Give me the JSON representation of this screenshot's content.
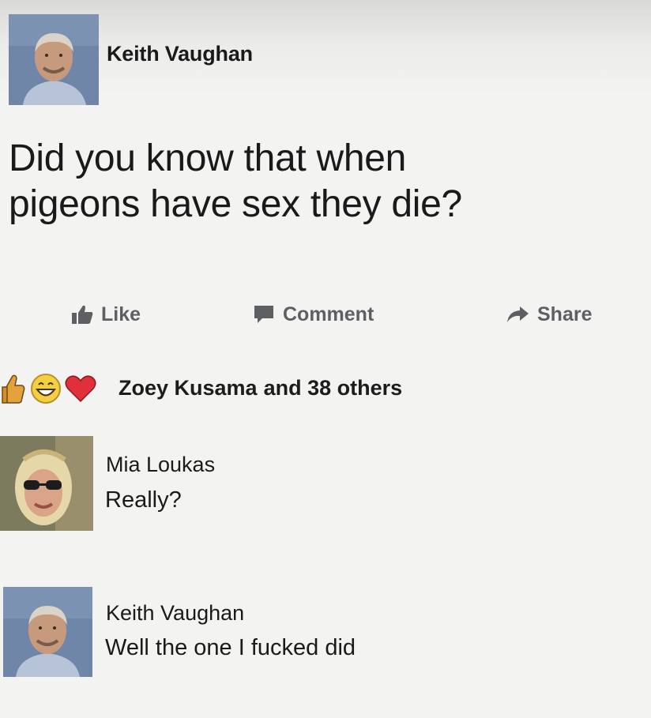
{
  "post": {
    "author": "Keith Vaughan",
    "text_line1": "Did you know that when",
    "text_line2": "pigeons have sex they die?"
  },
  "actions": {
    "like": "Like",
    "comment": "Comment",
    "share": "Share"
  },
  "reactions": {
    "icons": [
      "thumbs-up-icon",
      "grinning-face-icon",
      "heart-icon"
    ],
    "first_name": "Zoey Kusama",
    "others_text": "and 38 others"
  },
  "comments": [
    {
      "author": "Mia Loukas",
      "text": "Really?"
    },
    {
      "author": "Keith Vaughan",
      "text": "Well the one I fucked did"
    }
  ],
  "colors": {
    "background": "#f3f3f1",
    "action_gray": "#5d5f63",
    "like_blue": "#e5a13a",
    "heart_red": "#e0313b"
  }
}
